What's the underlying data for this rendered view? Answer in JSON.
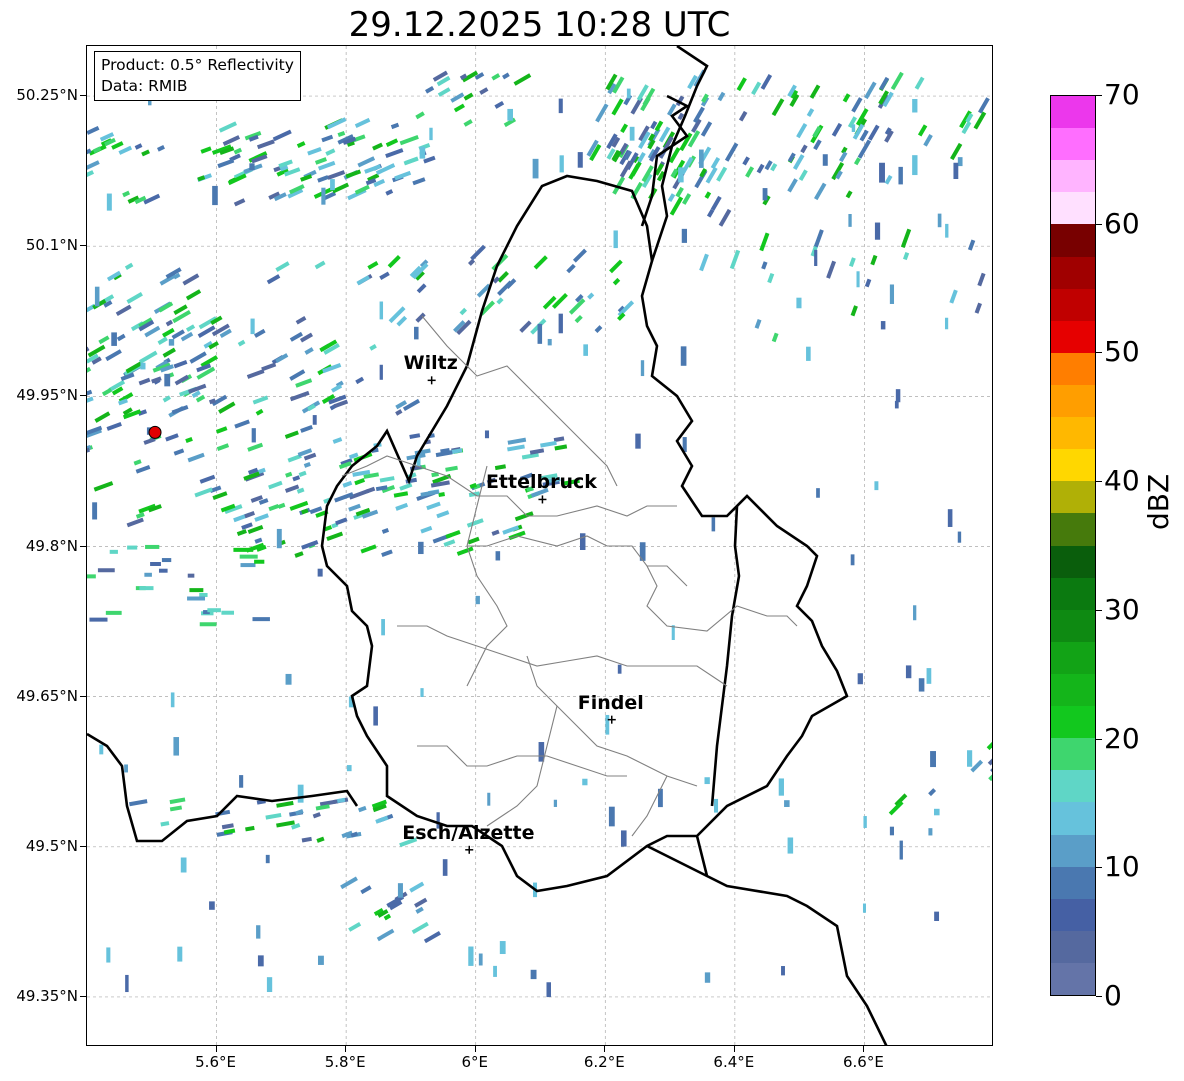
{
  "title": "29.12.2025 10:28 UTC",
  "info": {
    "product": "Product: 0.5° Reflectivity",
    "data": "Data: RMIB"
  },
  "axes": {
    "lon_range": [
      5.4,
      6.8
    ],
    "lat_range": [
      49.3,
      50.3
    ],
    "lat_ticks": [
      {
        "value": 50.25,
        "label": "50.25°N"
      },
      {
        "value": 50.1,
        "label": "50.1°N"
      },
      {
        "value": 49.95,
        "label": "49.95°N"
      },
      {
        "value": 49.8,
        "label": "49.8°N"
      },
      {
        "value": 49.65,
        "label": "49.65°N"
      },
      {
        "value": 49.5,
        "label": "49.5°N"
      },
      {
        "value": 49.35,
        "label": "49.35°N"
      }
    ],
    "lon_ticks": [
      {
        "value": 5.6,
        "label": "5.6°E"
      },
      {
        "value": 5.8,
        "label": "5.8°E"
      },
      {
        "value": 6.0,
        "label": "6°E"
      },
      {
        "value": 6.2,
        "label": "6.2°E"
      },
      {
        "value": 6.4,
        "label": "6.4°E"
      },
      {
        "value": 6.6,
        "label": "6.6°E"
      }
    ],
    "grid": true
  },
  "cities": [
    {
      "name": "Wiltz",
      "lon": 5.932,
      "lat": 49.966
    },
    {
      "name": "Ettelbruck",
      "lon": 6.103,
      "lat": 49.847
    },
    {
      "name": "Findel",
      "lon": 6.21,
      "lat": 49.627
    },
    {
      "name": "Esch/Alzette",
      "lon": 5.99,
      "lat": 49.497
    }
  ],
  "radar_site": {
    "lon": 5.505,
    "lat": 49.914,
    "color": "#e00000"
  },
  "colorbar": {
    "label": "dBZ",
    "min": 0,
    "max": 70,
    "ticks": [
      {
        "value": 70,
        "label": "70"
      },
      {
        "value": 60,
        "label": "60"
      },
      {
        "value": 50,
        "label": "50"
      },
      {
        "value": 40,
        "label": "40"
      },
      {
        "value": 30,
        "label": "30"
      },
      {
        "value": 20,
        "label": "20"
      },
      {
        "value": 10,
        "label": "10"
      },
      {
        "value": 0,
        "label": "0"
      }
    ],
    "colors": [
      "#6474a8",
      "#55699f",
      "#4560a4",
      "#4a78b0",
      "#5a9ec8",
      "#66c2dc",
      "#5fd6c6",
      "#3ed66e",
      "#12c81e",
      "#14b51a",
      "#12a316",
      "#0e8a12",
      "#0b7a10",
      "#0a5e0c",
      "#467a0c",
      "#b0b006",
      "#ffd700",
      "#ffb800",
      "#ff9e00",
      "#ff7e00",
      "#e60000",
      "#c00000",
      "#a00000",
      "#780000",
      "#ffe0ff",
      "#ffb4ff",
      "#ff6eff",
      "#ec37ec"
    ]
  }
}
